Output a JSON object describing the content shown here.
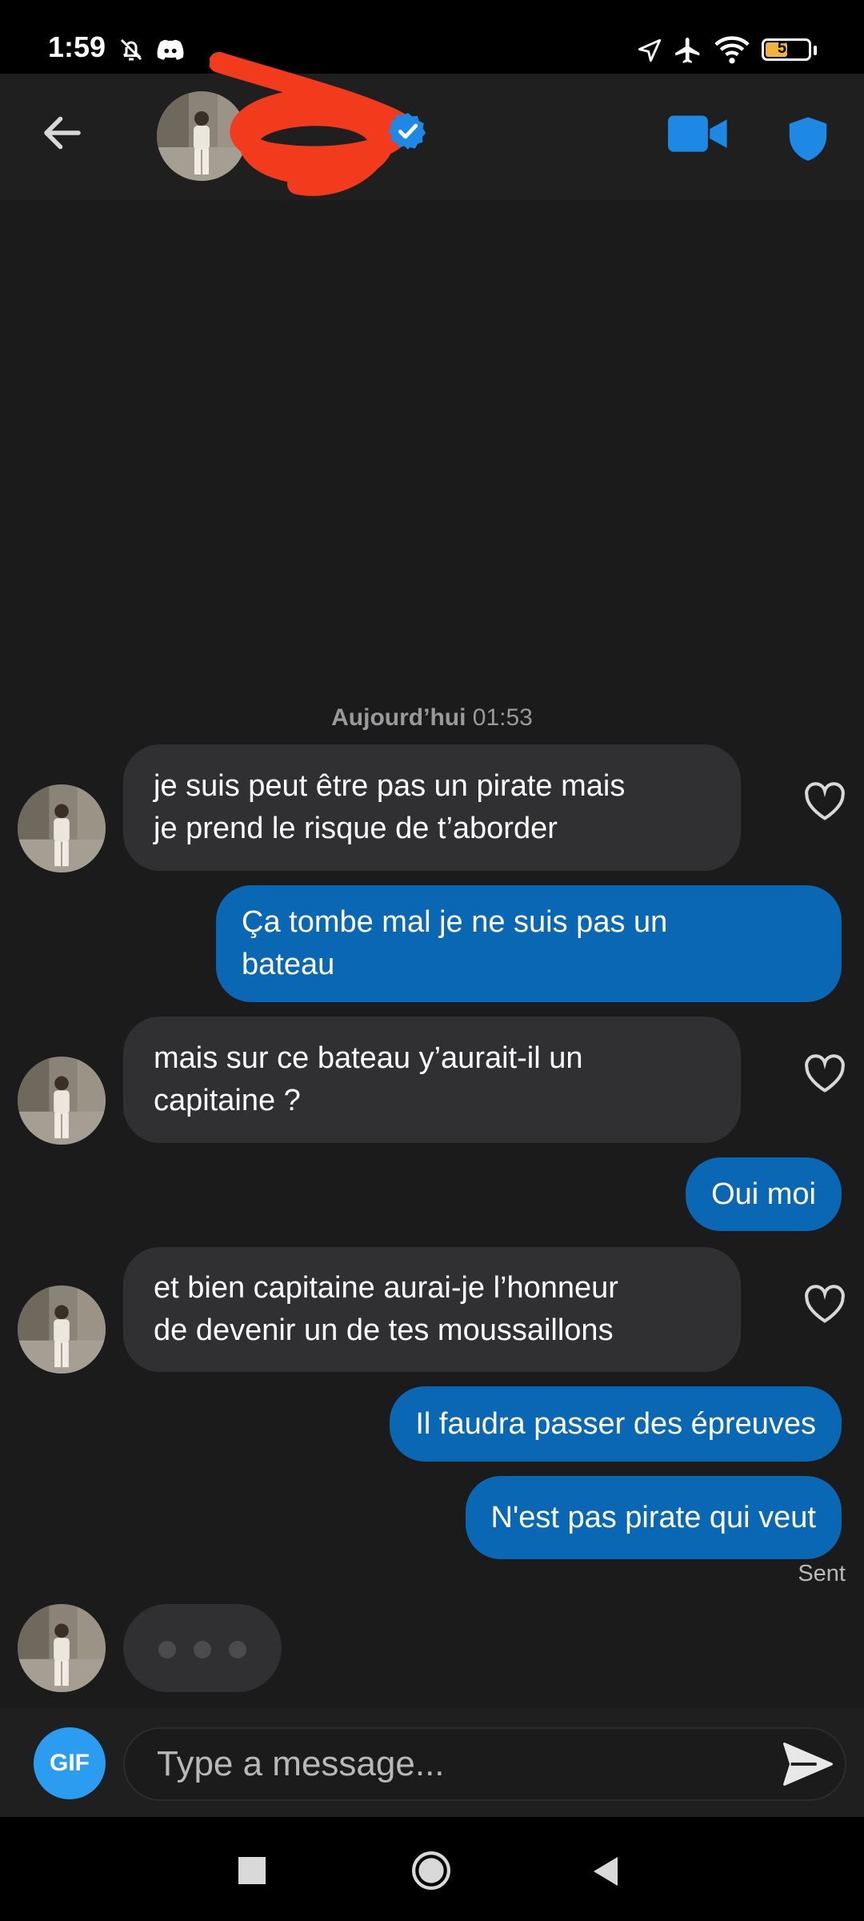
{
  "status_bar": {
    "time": "1:59",
    "battery": "52",
    "battery_level": 0.52,
    "icons": [
      "bell-off-icon",
      "discord-icon",
      "location-icon",
      "airplane-icon",
      "wifi-icon",
      "battery-icon"
    ]
  },
  "header": {
    "back_icon": "arrow-left-icon",
    "verified_icon": "verified-badge-icon",
    "video_icon": "video-camera-icon",
    "safety_icon": "shield-icon",
    "accent": "#1e88e5"
  },
  "conversation": {
    "date_label": "Aujourd’hui",
    "date_time": "01:53",
    "messages": [
      {
        "from": "them",
        "text_lines": [
          "je suis peut être pas un pirate mais",
          "je prend le risque de t’aborder"
        ]
      },
      {
        "from": "me",
        "text_lines": [
          "Ça tombe mal je ne suis pas un",
          "bateau"
        ]
      },
      {
        "from": "them",
        "text_lines": [
          "mais sur ce bateau y’aurait-il un",
          "capitaine ?"
        ]
      },
      {
        "from": "me",
        "text_lines": [
          "Oui moi"
        ]
      },
      {
        "from": "them",
        "text_lines": [
          "et bien capitaine aurai-je l’honneur",
          "de devenir un de tes moussaillons"
        ]
      },
      {
        "from": "me",
        "text_lines": [
          "Il faudra passer des épreuves"
        ]
      },
      {
        "from": "me",
        "text_lines": [
          "N'est pas pirate qui veut"
        ]
      }
    ],
    "status": "Sent",
    "typing_indicator": true
  },
  "composer": {
    "gif_label": "GIF",
    "placeholder": "Type a message...",
    "send_icon": "send-icon"
  },
  "colors": {
    "background": "#1b1b1c",
    "incoming_bubble": "#303032",
    "outgoing_bubble": "#0a67b3",
    "gif_button": "#2c9cf0"
  },
  "nav_bar": {
    "icons": [
      "recents-square-icon",
      "home-circle-icon",
      "back-triangle-icon"
    ]
  }
}
